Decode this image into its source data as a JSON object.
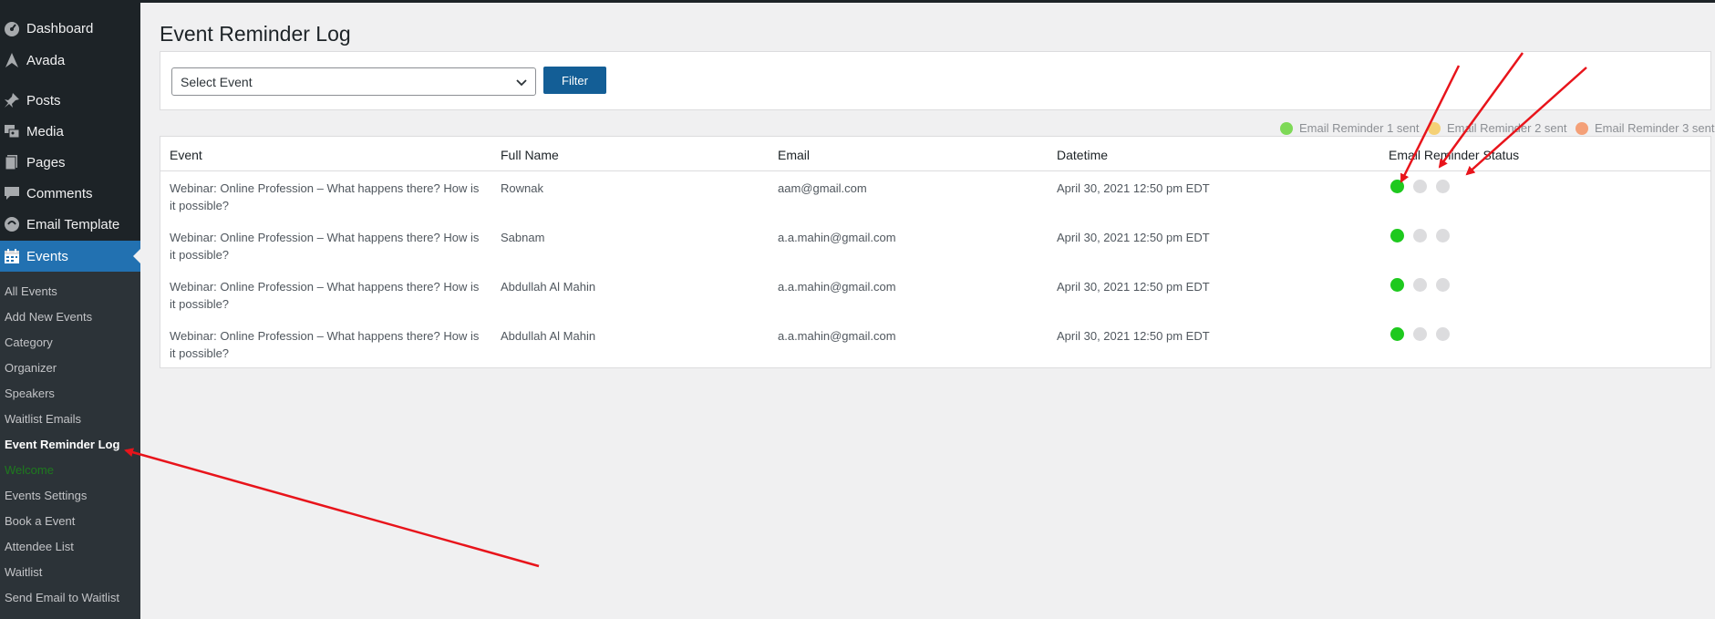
{
  "sidebar": {
    "menu": [
      {
        "label": "Dashboard",
        "icon": "dashboard-icon"
      },
      {
        "label": "Avada",
        "icon": "avada-icon"
      },
      {
        "label": "Posts",
        "icon": "pin-icon"
      },
      {
        "label": "Media",
        "icon": "media-icon"
      },
      {
        "label": "Pages",
        "icon": "pages-icon"
      },
      {
        "label": "Comments",
        "icon": "comments-icon"
      },
      {
        "label": "Email Template",
        "icon": "email-template-icon"
      },
      {
        "label": "Events",
        "icon": "calendar-icon",
        "active": true
      }
    ],
    "submenu": [
      "All Events",
      "Add New Events",
      "Category",
      "Organizer",
      "Speakers",
      "Waitlist Emails",
      "Event Reminder Log",
      "Welcome",
      "Events Settings",
      "Book a Event",
      "Attendee List",
      "Waitlist",
      "Send Email to Waitlist"
    ],
    "current_submenu": "Event Reminder Log"
  },
  "page": {
    "title": "Event Reminder Log"
  },
  "filter": {
    "select_value": "Select Event",
    "button_label": "Filter"
  },
  "legend": [
    {
      "label": "Email Reminder 1 sent",
      "color": "#7ed957"
    },
    {
      "label": "Email Reminder 2 sent",
      "color": "#f5d176"
    },
    {
      "label": "Email Reminder 3 sent",
      "color": "#f4a078"
    }
  ],
  "table": {
    "headers": [
      "Event",
      "Full Name",
      "Email",
      "Datetime",
      "Email Reminder Status"
    ],
    "rows": [
      {
        "event": "Webinar: Online Profession – What happens there? How is it possible?",
        "name": "Rownak",
        "email": "aam@gmail.com",
        "datetime": "April 30, 2021 12:50 pm EDT",
        "status": [
          "sent",
          "pending",
          "pending"
        ]
      },
      {
        "event": "Webinar: Online Profession – What happens there? How is it possible?",
        "name": "Sabnam",
        "email": "a.a.mahin@gmail.com",
        "datetime": "April 30, 2021 12:50 pm EDT",
        "status": [
          "sent",
          "pending",
          "pending"
        ]
      },
      {
        "event": "Webinar: Online Profession – What happens there? How is it possible?",
        "name": "Abdullah Al Mahin",
        "email": "a.a.mahin@gmail.com",
        "datetime": "April 30, 2021 12:50 pm EDT",
        "status": [
          "sent",
          "pending",
          "pending"
        ]
      },
      {
        "event": "Webinar: Online Profession – What happens there? How is it possible?",
        "name": "Abdullah Al Mahin",
        "email": "a.a.mahin@gmail.com",
        "datetime": "April 30, 2021 12:50 pm EDT",
        "status": [
          "sent",
          "pending",
          "pending"
        ]
      }
    ]
  },
  "colors": {
    "sent": "#1ec91e",
    "pending": "#dcdcde",
    "annotation_arrow": "#e8141b",
    "active_menu": "#2271b1",
    "filter_button": "#135e96"
  }
}
